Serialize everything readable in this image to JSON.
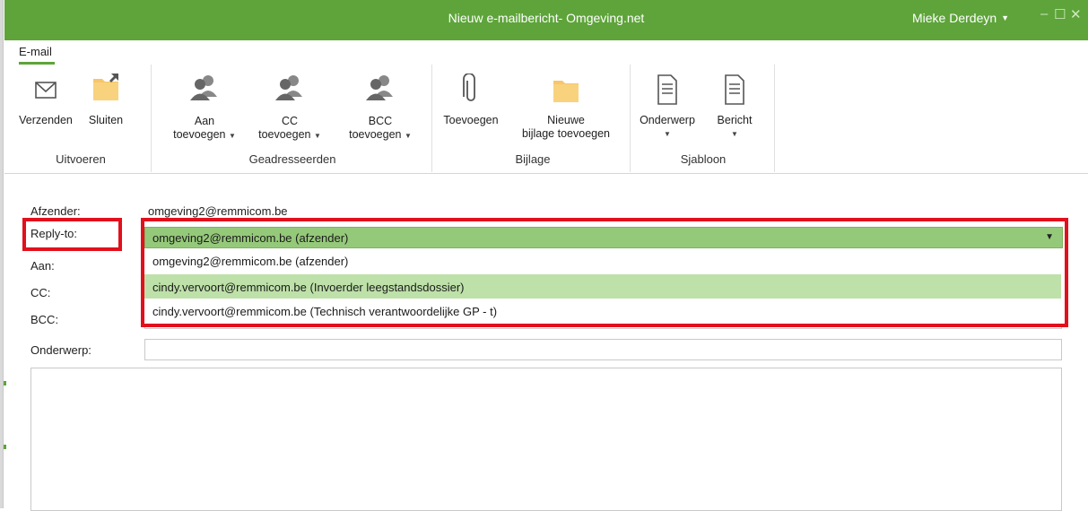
{
  "window": {
    "title": "Nieuw e-mailbericht- Omgeving.net",
    "user": "Mieke Derdeyn",
    "minimize": "–",
    "maximize": "☐",
    "close": "✕"
  },
  "ribbon": {
    "tab": "E-mail",
    "groups": {
      "uitvoeren": "Uitvoeren",
      "geadresseerden": "Geadresseerden",
      "bijlage": "Bijlage",
      "sjabloon": "Sjabloon"
    },
    "buttons": {
      "verzenden": "Verzenden",
      "sluiten": "Sluiten",
      "aan_line1": "Aan",
      "aan_line2": "toevoegen",
      "cc_line1": "CC",
      "cc_line2": "toevoegen",
      "bcc_line1": "BCC",
      "bcc_line2": "toevoegen",
      "toevoegen": "Toevoegen",
      "nieuwe_line1": "Nieuwe",
      "nieuwe_line2": "bijlage toevoegen",
      "onderwerp": "Onderwerp",
      "bericht": "Bericht"
    },
    "dropdown_arrow": "▼"
  },
  "form": {
    "labels": {
      "afzender": "Afzender:",
      "reply_to": "Reply-to:",
      "aan": "Aan:",
      "cc": "CC:",
      "bcc": "BCC:",
      "onderwerp": "Onderwerp:"
    },
    "afzender_value": "omgeving2@remmicom.be",
    "reply_to": {
      "selected": "omgeving2@remmicom.be (afzender)",
      "options": [
        "omgeving2@remmicom.be (afzender)",
        "cindy.vervoort@remmicom.be (Invoerder leegstandsdossier)",
        "cindy.vervoort@remmicom.be (Technisch verantwoordelijke GP - t)"
      ]
    }
  },
  "colors": {
    "accent": "#5ea43a",
    "highlight_red": "#e2101c",
    "selected_bg": "#95c97a",
    "hover_bg": "#bde1a8"
  },
  "icons": [
    "envelope-icon",
    "folder-icon",
    "people-icon",
    "paperclip-icon",
    "document-icon"
  ]
}
